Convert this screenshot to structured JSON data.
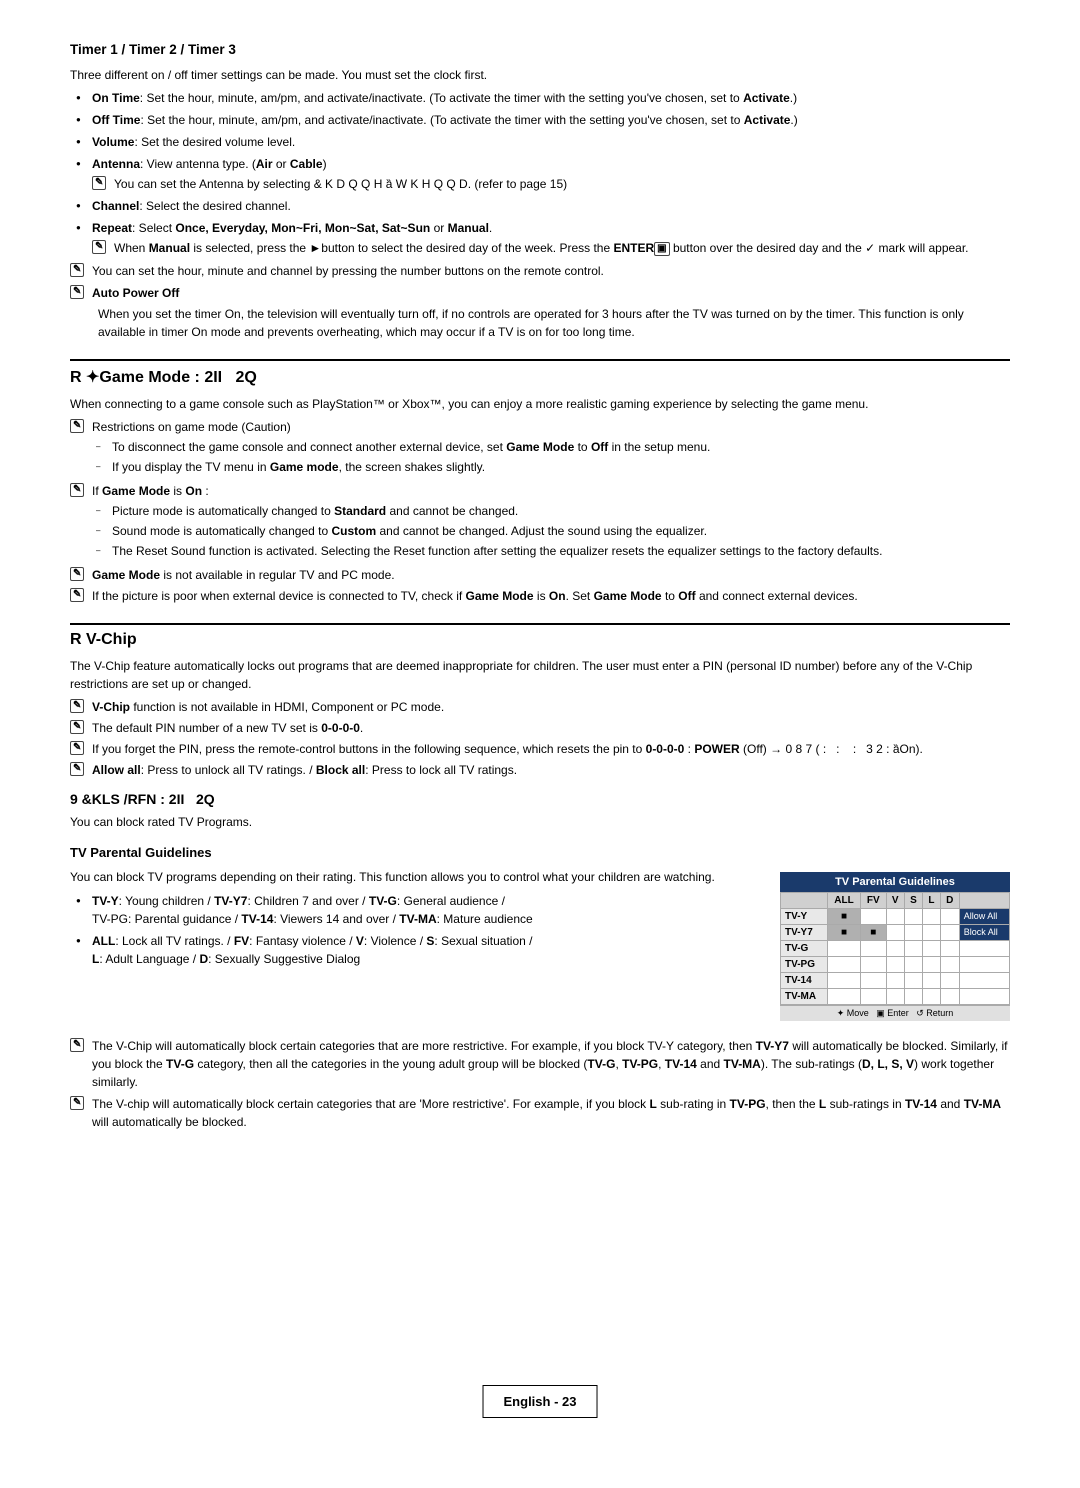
{
  "page": {
    "title": "English - 23",
    "footer_label": "English - 23",
    "sections": [
      {
        "id": "timer",
        "title": "Timer 1 / Timer 2 / Timer 3",
        "intro": "Three different on / off timer settings can be made. You must set the clock first.",
        "bullets": [
          {
            "text_parts": [
              {
                "bold": true,
                "text": "On Time"
              },
              {
                "bold": false,
                "text": ": Set the hour, minute, am/pm, and activate/inactivate. (To activate the timer with the setting you've chosen, set to "
              },
              {
                "bold": true,
                "text": "Activate"
              },
              {
                "bold": false,
                "text": ".)"
              }
            ]
          },
          {
            "text_parts": [
              {
                "bold": true,
                "text": "Off Time"
              },
              {
                "bold": false,
                "text": ": Set the hour, minute, am/pm, and activate/inactivate. (To activate the timer with the setting you've chosen, set to "
              },
              {
                "bold": true,
                "text": "Activate"
              },
              {
                "bold": false,
                "text": ".)"
              }
            ]
          },
          {
            "text_parts": [
              {
                "bold": true,
                "text": "Volume"
              },
              {
                "bold": false,
                "text": ": Set the desired volume level."
              }
            ]
          },
          {
            "text_parts": [
              {
                "bold": true,
                "text": "Antenna"
              },
              {
                "bold": false,
                "text": ": View antenna type. ("
              },
              {
                "bold": true,
                "text": "Air"
              },
              {
                "bold": false,
                "text": " or "
              },
              {
                "bold": true,
                "text": "Cable"
              },
              {
                "bold": false,
                "text": ")"
              }
            ],
            "subnote": "You can set the Antenna by selecting  & K D Q Q H ȁ W K H Q Q D. (refer to page 15)"
          },
          {
            "text_parts": [
              {
                "bold": true,
                "text": "Channel"
              },
              {
                "bold": false,
                "text": ": Select the desired channel."
              }
            ]
          },
          {
            "text_parts": [
              {
                "bold": true,
                "text": "Repeat"
              },
              {
                "bold": false,
                "text": ": Select "
              },
              {
                "bold": true,
                "text": "Once, Everyday, Mon~Fri, Mon~Sat, Sat~Sun"
              },
              {
                "bold": false,
                "text": " or "
              },
              {
                "bold": true,
                "text": "Manual"
              },
              {
                "bold": false,
                "text": "."
              }
            ],
            "subnote": "When Manual is selected, press the ►button to select the desired day of the week. Press the ENTER▣ button over the desired day and the ✓ mark will appear."
          }
        ],
        "notes": [
          "You can set the hour, minute and channel by pressing the number buttons on the remote control.",
          "Auto Power Off"
        ],
        "auto_power_off_text": "When you set the timer On, the television will eventually turn off, if no controls are operated for 3 hours after the TV was turned on by the timer. This function is only available in timer On mode and prevents overheating, which may occur if a TV is on for too long time."
      },
      {
        "id": "game_mode",
        "title": "R ✦ Game Mode : 2II  2Q",
        "display_title": "R ✦Game Mode  2II  2Q",
        "intro": "When connecting to a game console such as PlayStation™ or Xbox™, you can enjoy a more realistic gaming experience by selecting the game menu.",
        "notes": [
          {
            "label": "Restrictions on game mode (Caution)",
            "sub": [
              "To disconnect the game console and connect another external device, set Game Mode to Off in the setup menu.",
              "If you display the TV menu in Game mode, the screen shakes slightly."
            ]
          },
          {
            "label": "If Game Mode is On :",
            "sub": [
              "Picture mode is automatically changed to Standard and cannot be changed.",
              "Sound mode is automatically changed to Custom and cannot be changed. Adjust the sound using the equalizer.",
              "The Reset Sound function is activated. Selecting the Reset function after setting the equalizer resets the equalizer settings to the factory defaults."
            ]
          },
          {
            "label": "Game Mode is not available in regular TV and PC mode."
          },
          {
            "label": "If the picture is poor when external device is connected to TV, check if Game Mode is On. Set Game Mode to Off and connect external devices."
          }
        ]
      },
      {
        "id": "vchip",
        "title": "R V-Chip",
        "intro": "The V-Chip feature automatically locks out programs that are deemed inappropriate for children. The user must enter a PIN (personal ID number) before any of the V-Chip restrictions are set up or changed.",
        "notes": [
          "V-Chip function is not available in HDMI, Component or PC mode.",
          "The default PIN number of a new TV set is 0-0-0-0.",
          "If you forget the PIN, press the remote-control buttons in the following sequence, which resets the pin to 0-0-0-0 : POWER (Off) → 0 8 7 (  :    :     :   3 2 : ȁOn).",
          "Allow all: Press to unlock all TV ratings. / Block all: Press to lock all TV ratings."
        ],
        "vchip_off_on": "9 &KLS /RFN : 2II  2Q",
        "block_text": "You can block rated TV Programs.",
        "tv_parental_title": "TV Parental Guidelines",
        "tv_parental_intro": "You can block TV programs depending on their rating. This function allows you to control what your children are watching.",
        "tv_ratings_bullets": [
          {
            "text_parts": [
              {
                "bold": true,
                "text": "TV-Y"
              },
              {
                "bold": false,
                "text": ": Young children / "
              },
              {
                "bold": true,
                "text": "TV-Y7"
              },
              {
                "bold": false,
                "text": ": Children 7 and over / "
              },
              {
                "bold": true,
                "text": "TV-G"
              },
              {
                "bold": false,
                "text": ": General audience /"
              },
              {
                "newline": true
              },
              {
                "bold": false,
                "text": "TV-PG"
              },
              {
                "bold": false,
                "text": ": Parental guidance / "
              },
              {
                "bold": true,
                "text": "TV-14"
              },
              {
                "bold": false,
                "text": ": Viewers 14 and over / "
              },
              {
                "bold": true,
                "text": "TV-MA"
              },
              {
                "bold": false,
                "text": ": Mature audience"
              }
            ]
          },
          {
            "text_parts": [
              {
                "bold": true,
                "text": "ALL"
              },
              {
                "bold": false,
                "text": ": Lock all TV ratings. / "
              },
              {
                "bold": true,
                "text": "FV"
              },
              {
                "bold": false,
                "text": ": Fantasy violence / "
              },
              {
                "bold": true,
                "text": "V"
              },
              {
                "bold": false,
                "text": ": Violence / "
              },
              {
                "bold": true,
                "text": "S"
              },
              {
                "bold": false,
                "text": ": Sexual situation /"
              },
              {
                "newline": true
              },
              {
                "bold": true,
                "text": "L"
              },
              {
                "bold": false,
                "text": ": Adult Language / "
              },
              {
                "bold": true,
                "text": "D"
              },
              {
                "bold": false,
                "text": ": Sexually Suggestive Dialog"
              }
            ]
          }
        ],
        "vchip_auto_note1": "The V-Chip will automatically block certain categories that are more restrictive. For example, if you block TV-Y category, then TV-Y7 will automatically be blocked. Similarly, if you block the TV-G category, then all the categories in the young adult group will be blocked (TV-G, TV-PG, TV-14 and TV-MA). The sub-ratings (D, L, S, V) work together similarly.",
        "vchip_auto_note2": "The V-chip will automatically block certain categories that are 'More restrictive'. For example, if you block L sub-rating in TV-PG, then the L sub-ratings in TV-14 and TV-MA will automatically be blocked.",
        "table": {
          "caption": "TV Parental Guidelines",
          "headers": [
            "",
            "ALL",
            "FV",
            "V",
            "S",
            "L",
            "D",
            "",
            ""
          ],
          "rows": [
            {
              "label": "TV-Y",
              "cells": [
                "checked",
                "",
                "",
                "",
                "",
                "",
                "",
                "Allow All"
              ]
            },
            {
              "label": "TV-Y7",
              "cells": [
                "checked",
                "checked",
                "",
                "",
                "",
                "",
                "",
                "Block All"
              ]
            },
            {
              "label": "TV-G",
              "cells": [
                "",
                "",
                "",
                "",
                "",
                "",
                "",
                ""
              ]
            },
            {
              "label": "TV-PG",
              "cells": [
                "",
                "",
                "",
                "",
                "",
                "",
                "",
                ""
              ]
            },
            {
              "label": "TV-14",
              "cells": [
                "",
                "",
                "",
                "",
                "",
                "",
                "",
                ""
              ]
            },
            {
              "label": "TV-MA",
              "cells": [
                "",
                "",
                "",
                "",
                "",
                "",
                "",
                ""
              ]
            }
          ],
          "footer": "✦ Move  ▣ Enter  ↺ Return"
        }
      }
    ]
  }
}
